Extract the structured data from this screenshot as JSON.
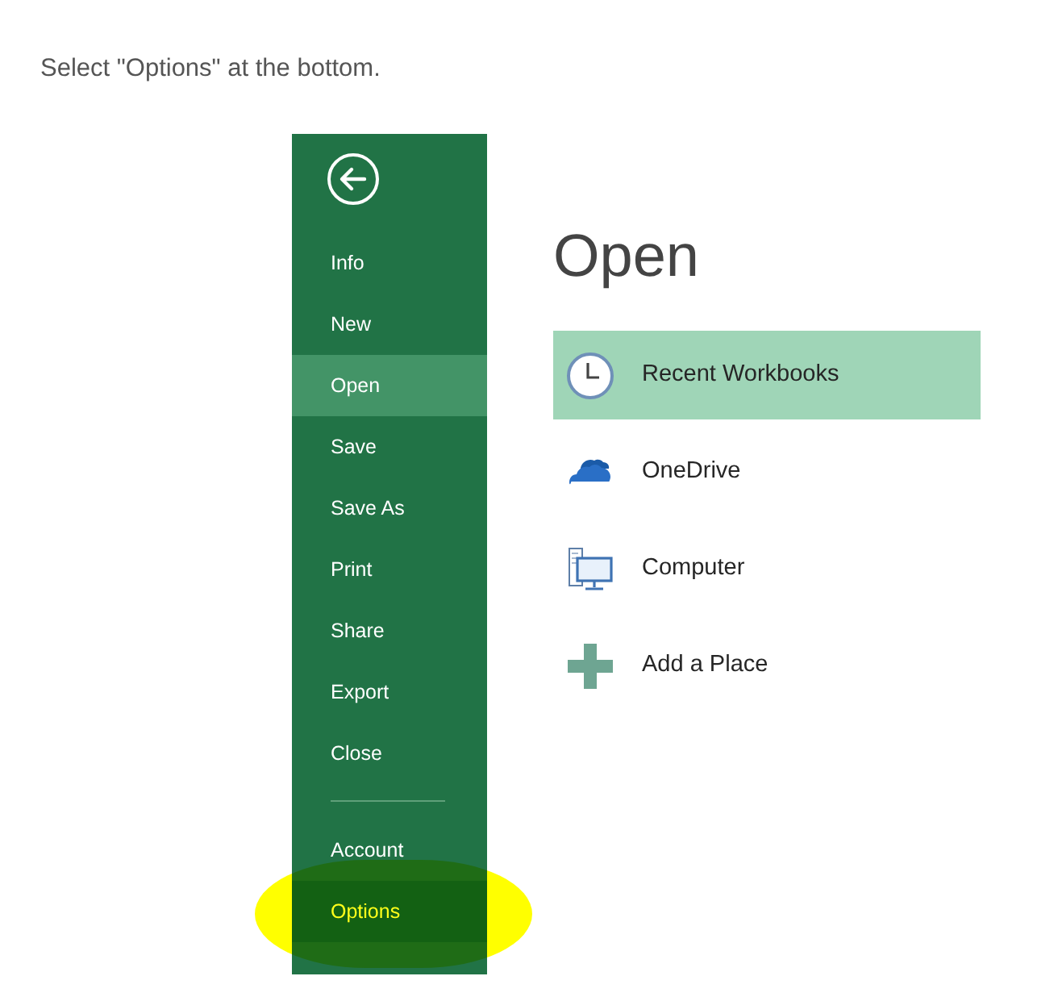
{
  "instruction": "Select \"Options\" at the bottom.",
  "sidebar": {
    "main_items": [
      {
        "label": "Info",
        "selected": false,
        "highlighted": false
      },
      {
        "label": "New",
        "selected": false,
        "highlighted": false
      },
      {
        "label": "Open",
        "selected": true,
        "highlighted": false
      },
      {
        "label": "Save",
        "selected": false,
        "highlighted": false
      },
      {
        "label": "Save As",
        "selected": false,
        "highlighted": false
      },
      {
        "label": "Print",
        "selected": false,
        "highlighted": false
      },
      {
        "label": "Share",
        "selected": false,
        "highlighted": false
      },
      {
        "label": "Export",
        "selected": false,
        "highlighted": false
      },
      {
        "label": "Close",
        "selected": false,
        "highlighted": false
      }
    ],
    "bottom_items": [
      {
        "label": "Account",
        "selected": false,
        "highlighted": false
      },
      {
        "label": "Options",
        "selected": false,
        "highlighted": true
      }
    ]
  },
  "panel": {
    "title": "Open",
    "locations": [
      {
        "kind": "recent",
        "label": "Recent Workbooks",
        "selected": true
      },
      {
        "kind": "onedrive",
        "label": "OneDrive",
        "selected": false
      },
      {
        "kind": "computer",
        "label": "Computer",
        "selected": false
      },
      {
        "kind": "add",
        "label": "Add a Place",
        "selected": false
      }
    ]
  }
}
